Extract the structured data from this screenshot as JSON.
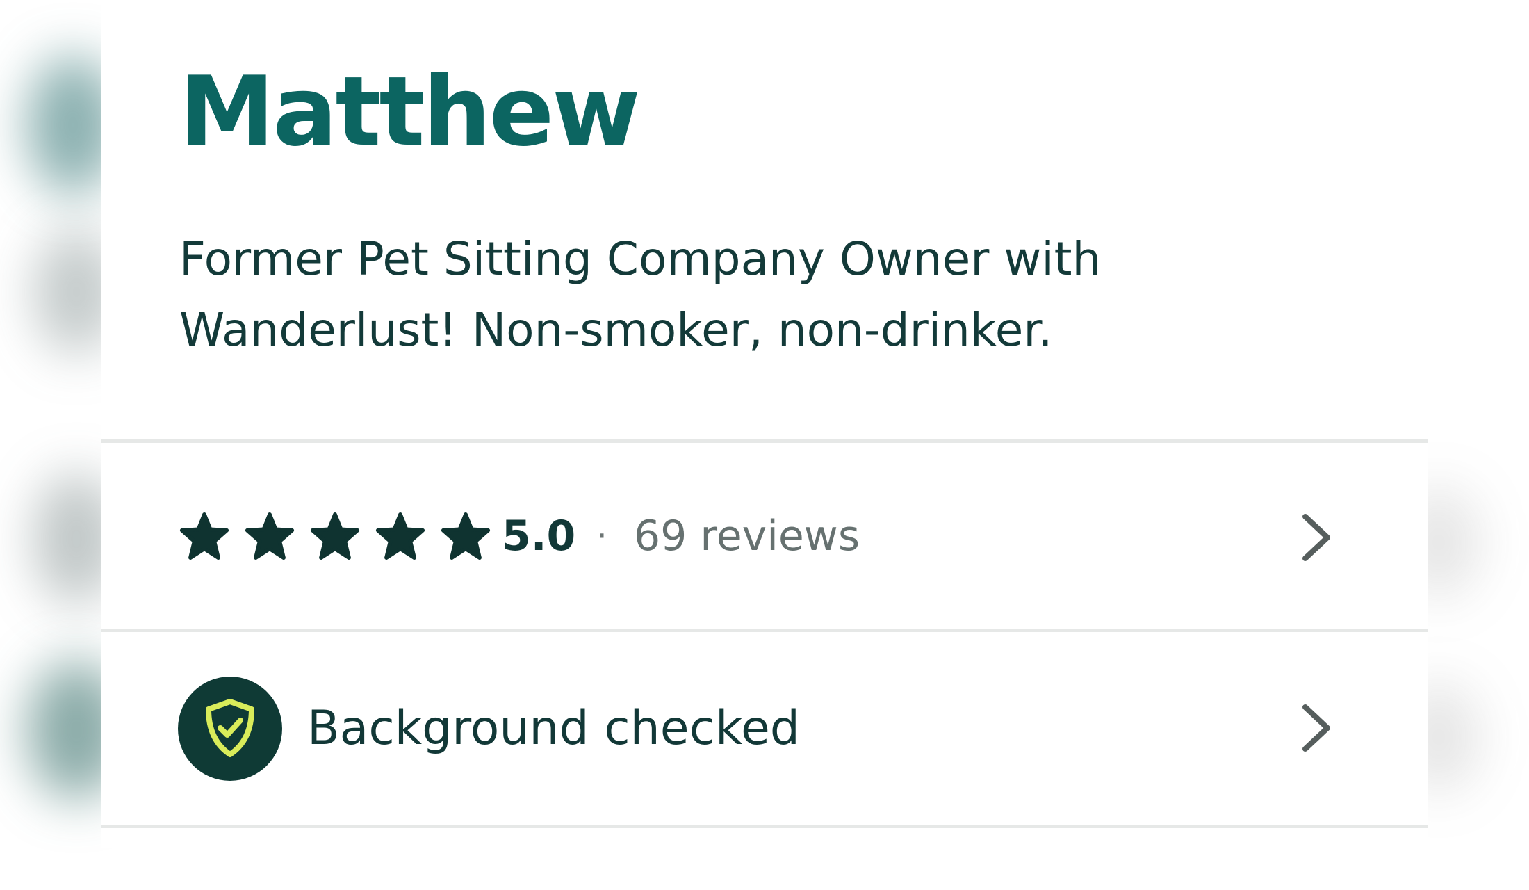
{
  "profile": {
    "name": "Matthew",
    "tagline": "Former Pet Sitting Company Owner with\nWanderlust!  Non-smoker, non-drinker."
  },
  "reviews": {
    "stars": 5,
    "rating": "5.0",
    "separator": "·",
    "count_label": "69 reviews",
    "icon": "chevron-right-icon"
  },
  "background_check": {
    "label": "Background checked",
    "icon": "shield-check-icon"
  },
  "colors": {
    "name": "#0c6561",
    "text": "#133a39",
    "muted": "#667170",
    "badge_bg": "#0f3a35",
    "badge_icon": "#d9ec5a",
    "star": "#0f3330",
    "divider": "#e6e8e7"
  }
}
